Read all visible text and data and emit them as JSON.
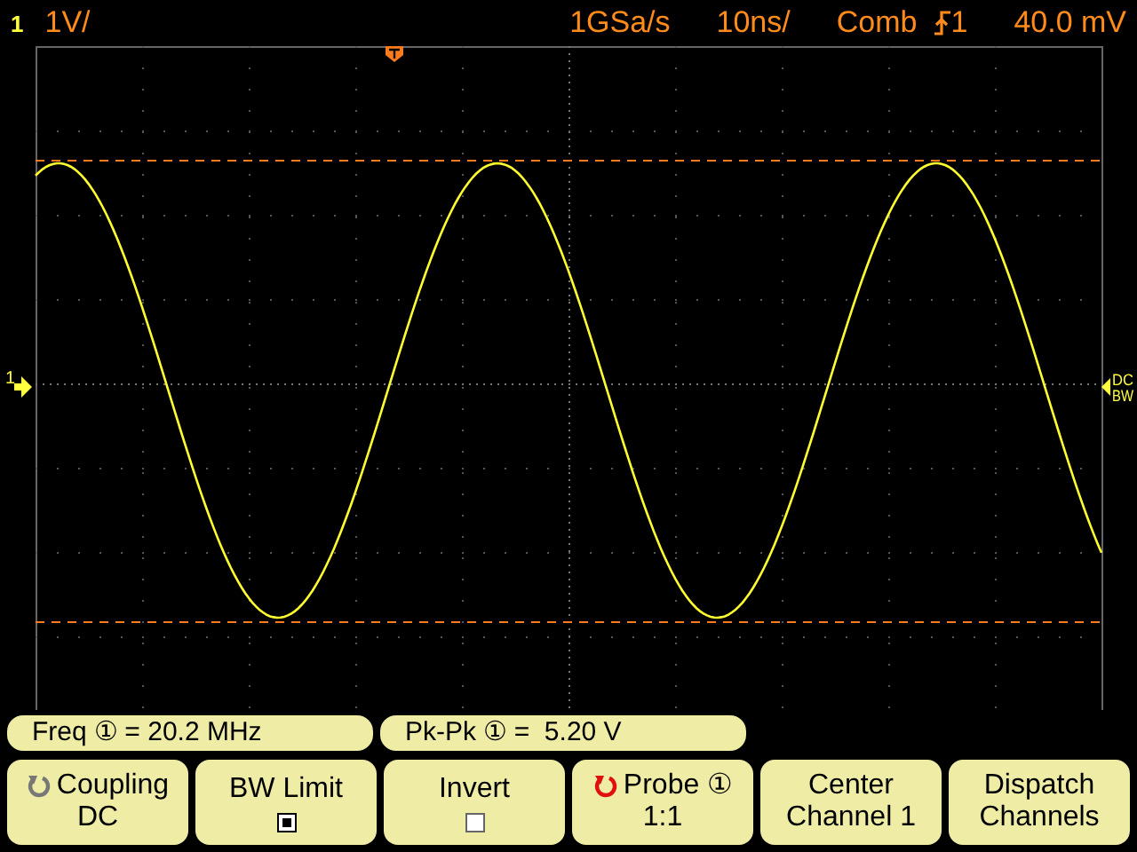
{
  "header": {
    "channel": "1",
    "volts_per_div": "1V/",
    "sample_rate": "1GSa/s",
    "time_per_div": "10ns/",
    "trigger_mode": "Comb",
    "trigger_source": "1",
    "trigger_level": "40.0 mV"
  },
  "screen": {
    "ground_marker": "1",
    "channel_info": [
      "DC",
      "BW"
    ]
  },
  "measurements": [
    {
      "label": "Freq ① = 20.2 MHz"
    },
    {
      "label": "Pk-Pk ① =  5.20 V"
    }
  ],
  "softkeys": [
    {
      "kind": "knob",
      "label": "Coupling",
      "value": "DC",
      "active": false
    },
    {
      "kind": "checkbox",
      "label": "BW Limit",
      "checked": true
    },
    {
      "kind": "checkbox",
      "label": "Invert",
      "checked": false
    },
    {
      "kind": "knob",
      "label": "Probe ①",
      "value": "1:1",
      "active": true
    },
    {
      "kind": "value",
      "label": "Center",
      "value": "Channel 1"
    },
    {
      "kind": "value",
      "label": "Dispatch",
      "value": "Channels"
    }
  ]
}
